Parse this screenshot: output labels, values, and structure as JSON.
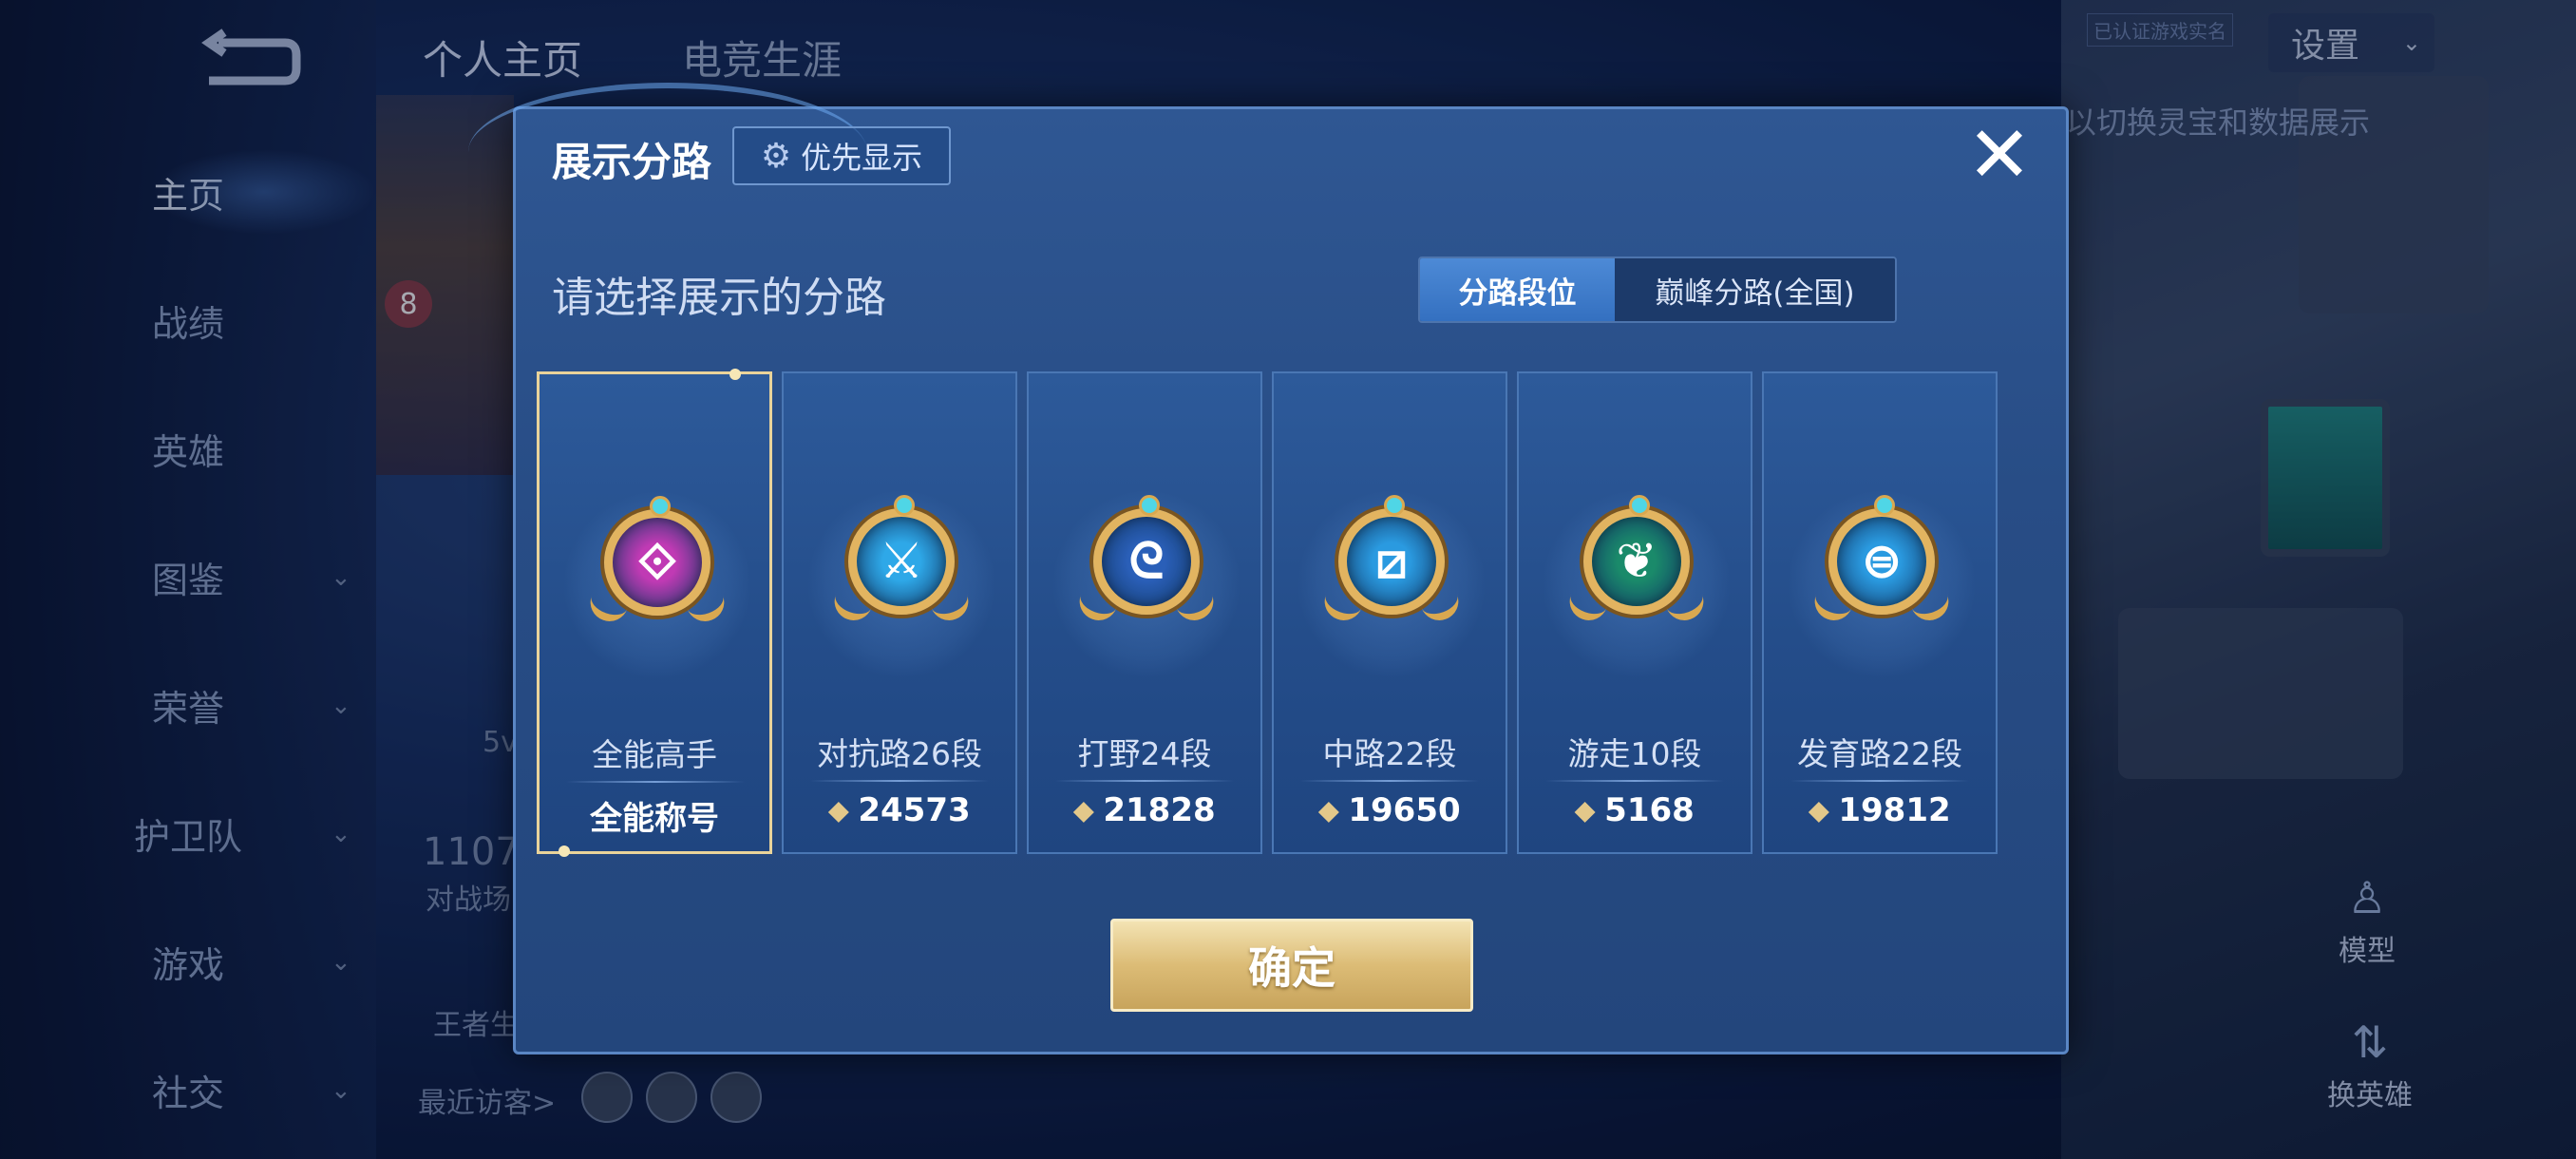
{
  "background": {
    "top_tabs": [
      "个人主页",
      "电竞生涯"
    ],
    "sidebar": [
      "主页",
      "战绩",
      "英雄",
      "图鉴",
      "荣誉",
      "护卫队",
      "游戏",
      "社交"
    ],
    "sidebar_chevrons": [
      false,
      false,
      false,
      true,
      true,
      true,
      true,
      true
    ],
    "settings_label": "设置",
    "right_hint": "以切换灵宝和数据展示",
    "model_label": "模型",
    "switch_hero_label": "换英雄",
    "recent_visitors_label": "最近访客>",
    "battle_count": "1107",
    "battle_label": "对战场",
    "five_v": "5v",
    "king_label": "王者生",
    "level_badge": "8",
    "top_small_text": "已认证游戏实名"
  },
  "dialog": {
    "title": "展示分路",
    "priority_label": "优先显示",
    "subtitle": "请选择展示的分路",
    "toggle": [
      "分路段位",
      "巅峰分路(全国)"
    ],
    "confirm_label": "确定"
  },
  "cards": [
    {
      "name": "全能高手",
      "value": "全能称号",
      "show_icon": false,
      "color": "#c03ab4",
      "glyph": "⟐"
    },
    {
      "name": "对抗路26段",
      "value": "24573",
      "show_icon": true,
      "color": "#2ea8e8",
      "glyph": "⚔"
    },
    {
      "name": "打野24段",
      "value": "21828",
      "show_icon": true,
      "color": "#2a5fb8",
      "glyph": "ᘓ"
    },
    {
      "name": "中路22段",
      "value": "19650",
      "show_icon": true,
      "color": "#2a9ae0",
      "glyph": "⧄"
    },
    {
      "name": "游走10段",
      "value": "5168",
      "show_icon": true,
      "color": "#1a8a6a",
      "glyph": "❦"
    },
    {
      "name": "发育路22段",
      "value": "19812",
      "show_icon": true,
      "color": "#2a9ae0",
      "glyph": "⊜"
    }
  ]
}
